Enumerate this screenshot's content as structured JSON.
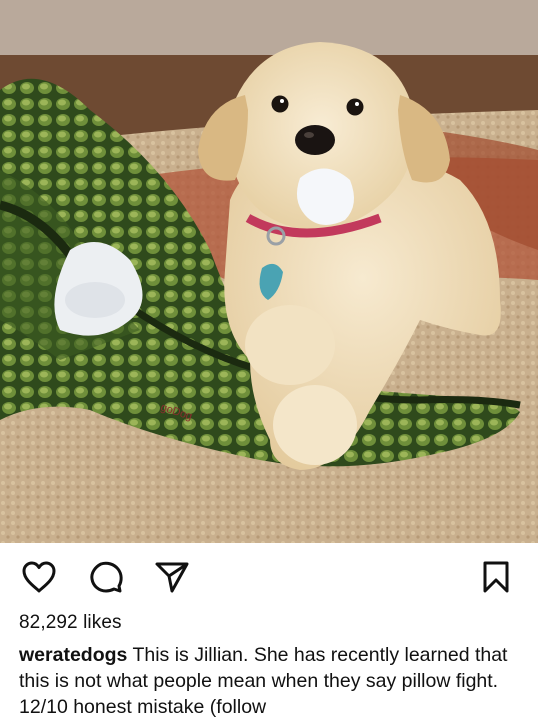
{
  "post": {
    "image_alt": "Golden retriever puppy lying on a green dinosaur plush toy with stuffing in its mouth",
    "actions": {
      "like_icon": "heart-outline-icon",
      "comment_icon": "speech-bubble-icon",
      "share_icon": "paper-plane-icon",
      "save_icon": "bookmark-outline-icon"
    },
    "likes": "82,292 likes",
    "caption": {
      "username": "weratedogs",
      "text": "This is Jillian. She has recently learned that this is not what people mean when they say pillow fight. 12/10 honest mistake (follow"
    }
  },
  "colors": {
    "text": "#111111",
    "icon": "#111111",
    "background": "#ffffff"
  }
}
